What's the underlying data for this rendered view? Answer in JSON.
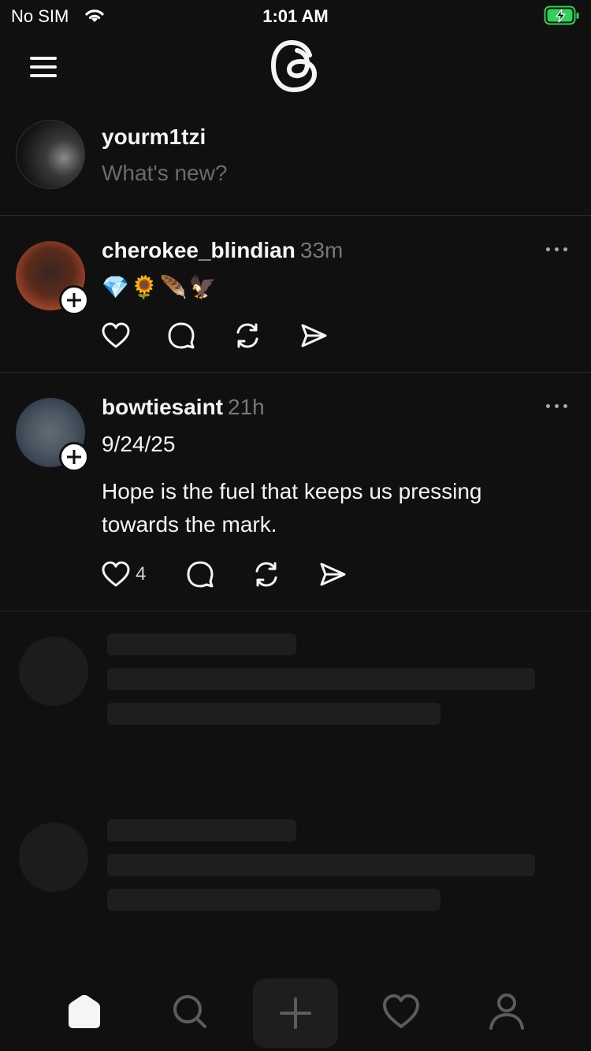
{
  "status_bar": {
    "carrier": "No SIM",
    "time": "1:01 AM"
  },
  "header": {
    "menu_icon": "hamburger-menu-icon",
    "logo_icon": "threads-logo-icon"
  },
  "composer": {
    "username": "yourm1tzi",
    "placeholder": "What's new?"
  },
  "posts": [
    {
      "username": "cherokee_blindian",
      "time": "33m",
      "text": "💎🌻🪶🦅",
      "like_count": ""
    },
    {
      "username": "bowtiesaint",
      "time": "21h",
      "date_line": "9/24/25",
      "text": "Hope is the fuel that keeps us pressing towards the mark.",
      "like_count": "4"
    }
  ],
  "tab_bar": {
    "items": [
      "home-icon",
      "search-icon",
      "compose-icon",
      "activity-icon",
      "profile-icon"
    ],
    "active": "home-icon"
  },
  "colors": {
    "background": "#101010",
    "text": "#f3f5f7",
    "muted": "#777777",
    "battery_green": "#30d158"
  }
}
